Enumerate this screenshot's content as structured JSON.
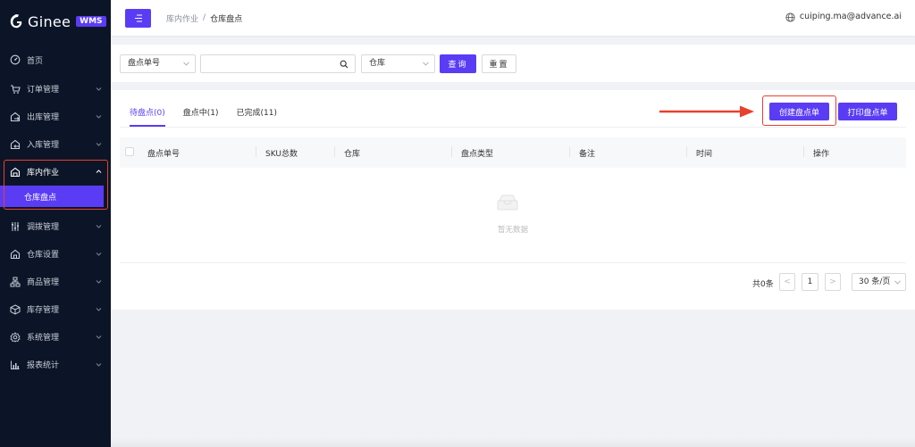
{
  "app": {
    "logo_text": "Ginee",
    "badge": "WMS"
  },
  "sidebar": {
    "items": [
      {
        "label": "首页",
        "icon": "dashboard-icon",
        "has_arrow": false
      },
      {
        "label": "订单管理",
        "icon": "cart-icon",
        "has_arrow": true
      },
      {
        "label": "出库管理",
        "icon": "outbound-icon",
        "has_arrow": true
      },
      {
        "label": "入库管理",
        "icon": "inbound-icon",
        "has_arrow": true
      },
      {
        "label": "库内作业",
        "icon": "warehouse-ops-icon",
        "has_arrow": true,
        "open": true
      },
      {
        "label": "调拨管理",
        "icon": "transfer-icon",
        "has_arrow": true
      },
      {
        "label": "仓库设置",
        "icon": "warehouse-settings-icon",
        "has_arrow": true
      },
      {
        "label": "商品管理",
        "icon": "product-icon",
        "has_arrow": true
      },
      {
        "label": "库存管理",
        "icon": "inventory-icon",
        "has_arrow": true
      },
      {
        "label": "系统管理",
        "icon": "system-gear-icon",
        "has_arrow": true
      },
      {
        "label": "报表统计",
        "icon": "report-chart-icon",
        "has_arrow": true
      }
    ],
    "active_sub": "仓库盘点"
  },
  "header": {
    "breadcrumb_parent": "库内作业",
    "breadcrumb_sep": "/",
    "breadcrumb_current": "仓库盘点",
    "user": "cuiping.ma@advance.ai"
  },
  "filter": {
    "field_select": "盘点单号",
    "search_value": "",
    "warehouse_select": "仓库",
    "query_label": "查询",
    "reset_label": "重置"
  },
  "tabs": [
    {
      "label": "待盘点(0)",
      "active": true
    },
    {
      "label": "盘点中(1)",
      "active": false
    },
    {
      "label": "已完成(11)",
      "active": false
    }
  ],
  "actions": {
    "create_label": "创建盘点单",
    "print_label": "打印盘点单"
  },
  "table": {
    "columns": [
      "盘点单号",
      "SKU总数",
      "仓库",
      "盘点类型",
      "备注",
      "时间",
      "操作"
    ],
    "empty_text": "暂无数据"
  },
  "pagination": {
    "total": "共0条",
    "prev": "<",
    "current": "1",
    "next": ">",
    "page_size": "30 条/页"
  },
  "colors": {
    "accent": "#5b3cf5",
    "annotation": "#e8412c",
    "sidebar_bg": "#0c1528"
  }
}
